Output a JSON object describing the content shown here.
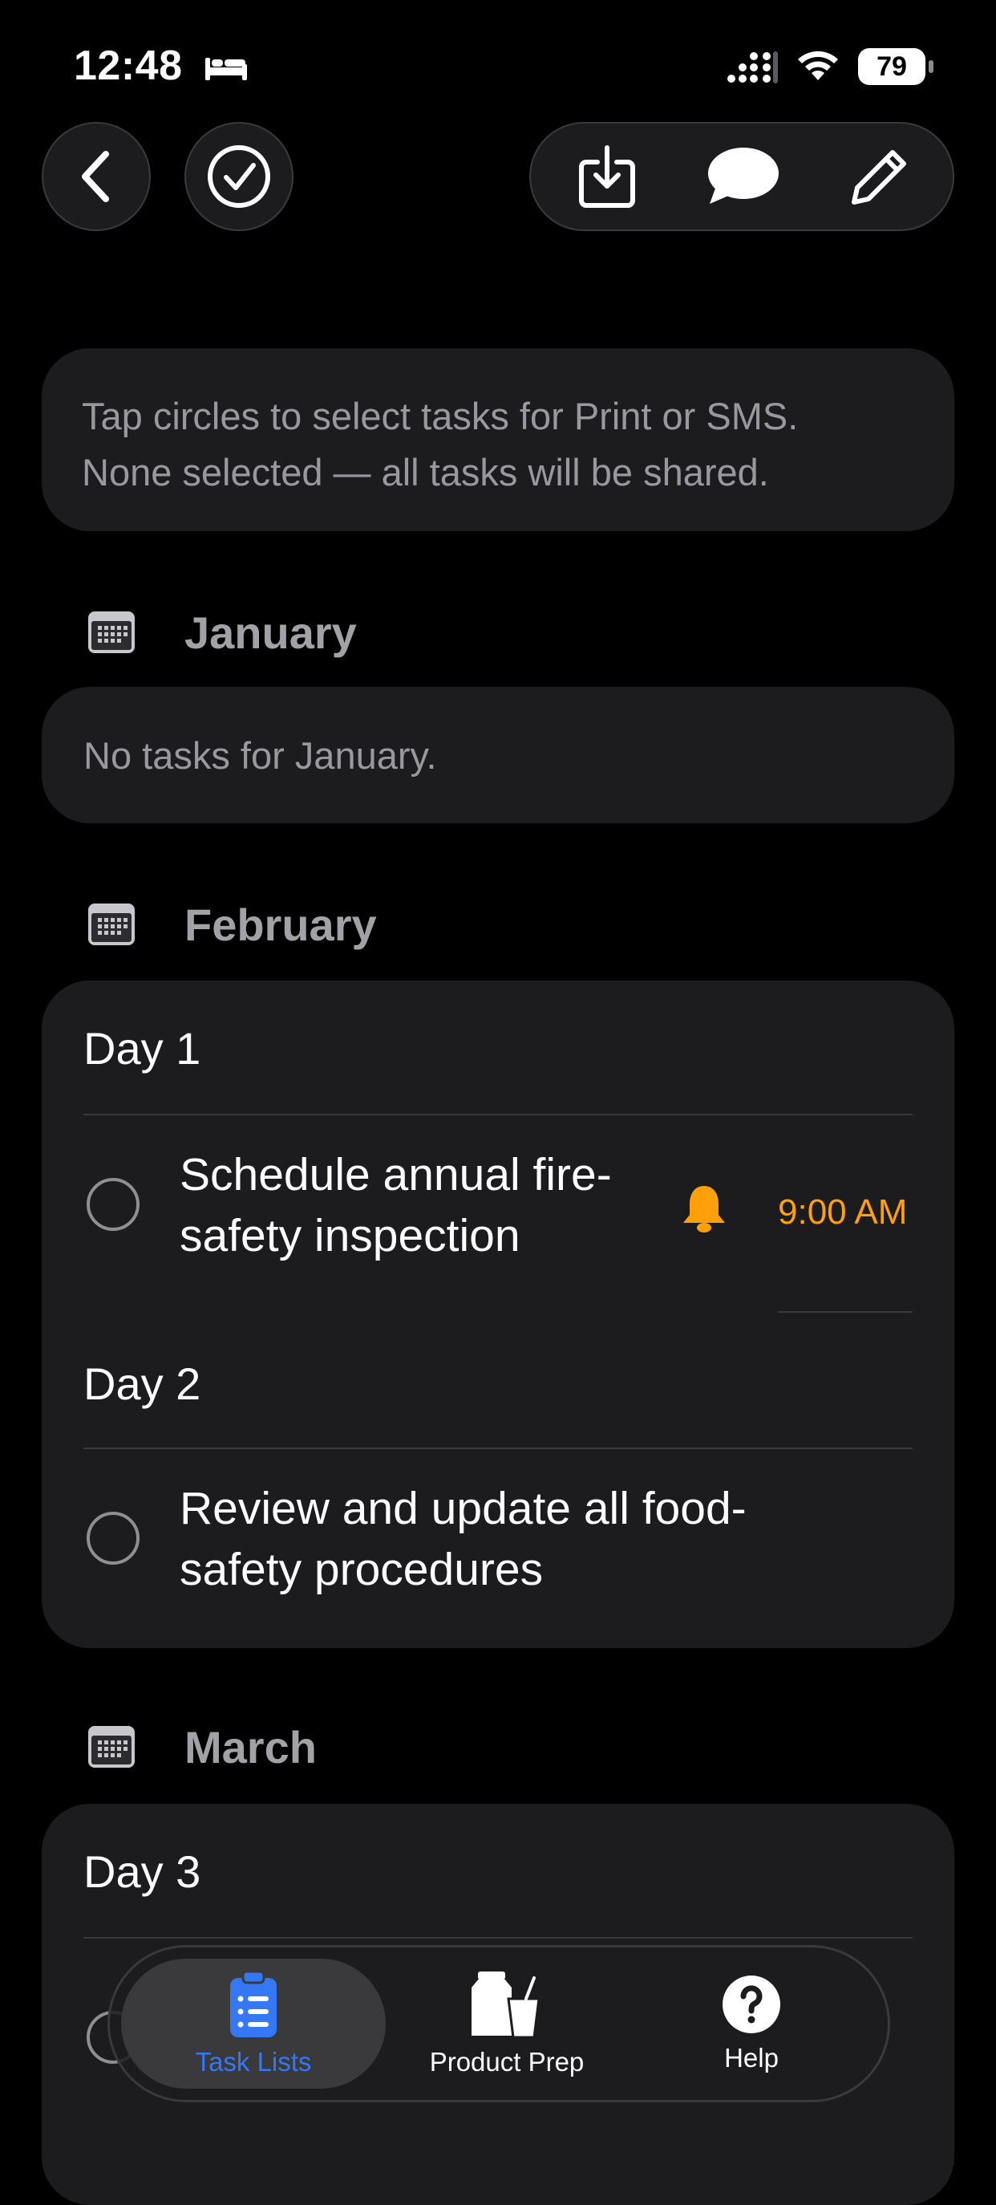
{
  "status_bar": {
    "time": "12:48",
    "battery": "79"
  },
  "nav": {
    "icons": [
      "chevron-left-icon",
      "checkmark-circle-icon",
      "download-icon",
      "message-bubble-icon",
      "pencil-icon"
    ]
  },
  "info": {
    "line1": "Tap circles to select tasks for Print or SMS.",
    "line2": "None selected — all tasks will be shared."
  },
  "months": [
    {
      "title": "January",
      "empty_text": "No tasks for January."
    },
    {
      "title": "February",
      "days": [
        {
          "label": "Day 1",
          "tasks": [
            {
              "line1": "Schedule annual fire-",
              "line2": "safety inspection",
              "time": "9:00 AM",
              "has_alarm": true
            }
          ]
        },
        {
          "label": "Day 2",
          "tasks": [
            {
              "line1": "Review and update all food-",
              "line2": "safety procedures"
            }
          ]
        }
      ]
    },
    {
      "title": "March",
      "days": [
        {
          "label": "Day 3"
        }
      ]
    }
  ],
  "tabbar": {
    "tabs": [
      {
        "label": "Task Lists",
        "active": true
      },
      {
        "label": "Product Prep",
        "active": false
      },
      {
        "label": "Help",
        "active": false
      }
    ]
  },
  "colors": {
    "accent": "#3478f6",
    "alarm": "#ff9f0a",
    "card": "#1c1c1e",
    "background": "#000000"
  }
}
